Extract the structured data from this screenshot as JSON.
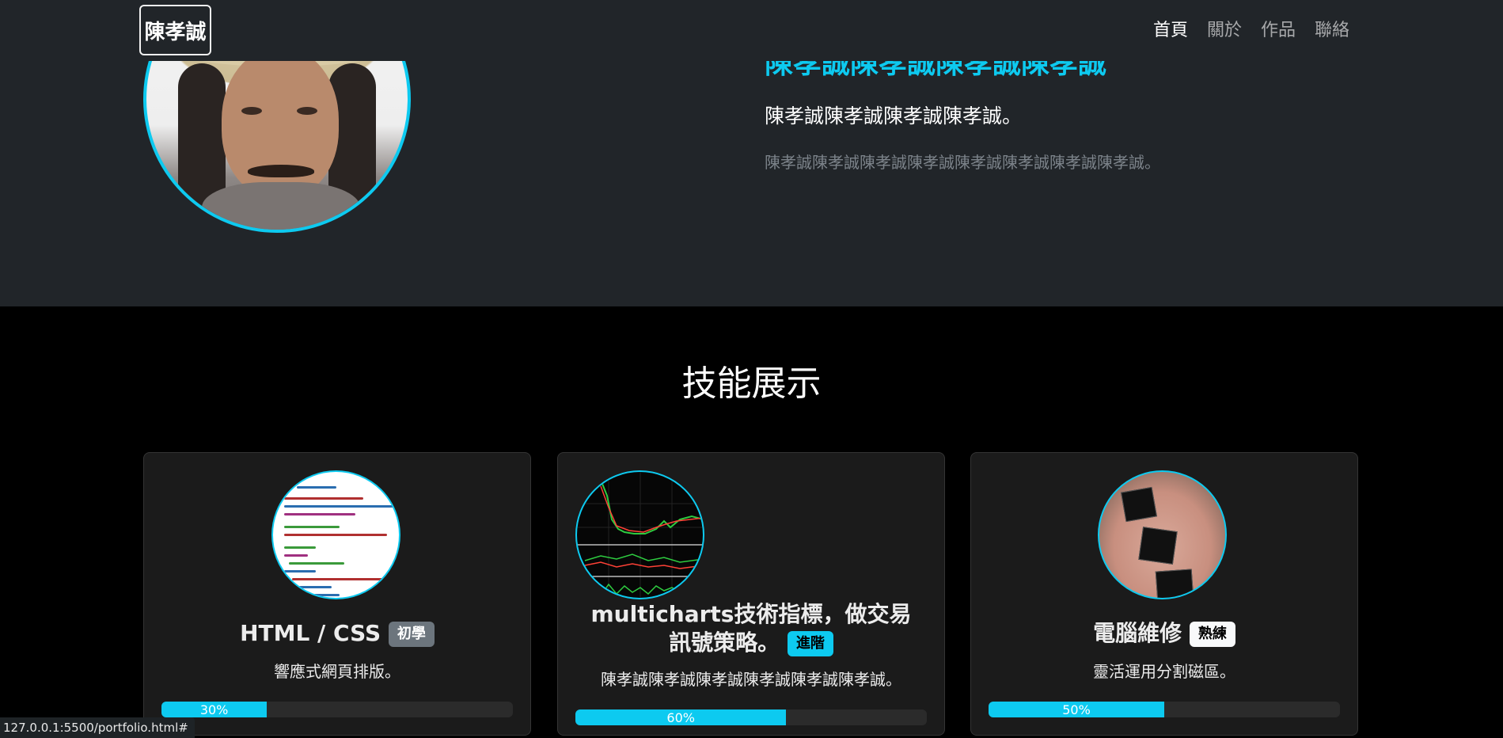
{
  "navbar": {
    "brand": "陳孝誠",
    "links": [
      "首頁",
      "關於",
      "作品",
      "聯絡"
    ]
  },
  "hero": {
    "title": "陳孝誠陳孝誠陳孝誠陳孝誠",
    "subtitle": "陳孝誠陳孝誠陳孝誠陳孝誠。",
    "description": "陳孝誠陳孝誠陳孝誠陳孝誠陳孝誠陳孝誠陳孝誠陳孝誠。"
  },
  "skills": {
    "heading": "技能展示",
    "cards": [
      {
        "title": "HTML / CSS",
        "badge": "初學",
        "description": "響應式網頁排版。",
        "progress_label": "30%",
        "progress": 0.3
      },
      {
        "title": "multicharts技術指標，做交易訊號策略。",
        "badge": "進階",
        "description": "陳孝誠陳孝誠陳孝誠陳孝誠陳孝誠陳孝誠。",
        "progress_label": "60%",
        "progress": 0.6
      },
      {
        "title": "電腦維修",
        "badge": "熟練",
        "description": "靈活運用分割磁區。",
        "progress_label": "50%",
        "progress": 0.5
      }
    ]
  },
  "statusbar": {
    "url": "127.0.0.1:5500/portfolio.html#"
  },
  "colors": {
    "accent": "#0dcaf0",
    "hero_bg": "#212529",
    "page_bg": "#000000"
  },
  "icons": {
    "avatar": "portrait-photo",
    "card1": "code-screenshot",
    "card2": "trading-chart",
    "card3": "chips-in-hand-photo"
  }
}
